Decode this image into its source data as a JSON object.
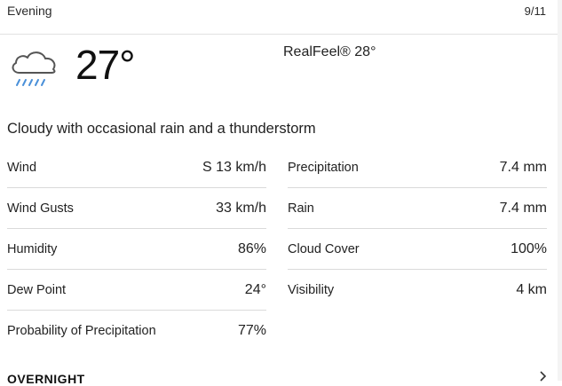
{
  "header": {
    "period": "Evening",
    "date": "9/11"
  },
  "current": {
    "icon": "cloud-rain-icon",
    "temperature": "27°",
    "realfeel": "RealFeel® 28°",
    "phrase": "Cloudy with occasional rain and a thunderstorm"
  },
  "details_left": [
    {
      "label": "Wind",
      "value": "S 13 km/h"
    },
    {
      "label": "Wind Gusts",
      "value": "33 km/h"
    },
    {
      "label": "Humidity",
      "value": "86%"
    },
    {
      "label": "Dew Point",
      "value": "24°"
    },
    {
      "label": "Probability of Precipitation",
      "value": "77%"
    }
  ],
  "details_right": [
    {
      "label": "Precipitation",
      "value": "7.4 mm"
    },
    {
      "label": "Rain",
      "value": "7.4 mm"
    },
    {
      "label": "Cloud Cover",
      "value": "100%"
    },
    {
      "label": "Visibility",
      "value": "4 km"
    }
  ],
  "next_section": {
    "title": "OVERNIGHT",
    "icon": "chevron-right-icon"
  },
  "colors": {
    "rain_icon": "#4a90d9",
    "cloud_icon": "#555555",
    "divider": "#dadada"
  }
}
